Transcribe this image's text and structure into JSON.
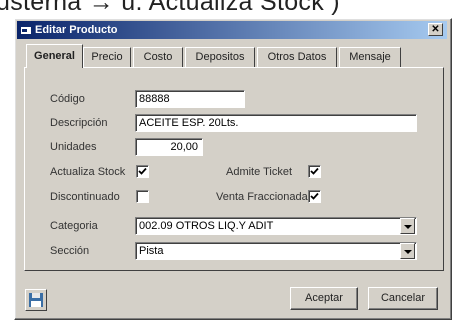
{
  "background_caption": "usterna → u.   Actualiza Stock )",
  "window": {
    "title": "Editar Producto",
    "close_label": "✕"
  },
  "tabs": [
    {
      "label": "General",
      "active": true
    },
    {
      "label": "Precio",
      "active": false
    },
    {
      "label": "Costo",
      "active": false
    },
    {
      "label": "Depositos",
      "active": false
    },
    {
      "label": "Otros Datos",
      "active": false
    },
    {
      "label": "Mensaje",
      "active": false
    }
  ],
  "form": {
    "codigo": {
      "label": "Código",
      "value": "88888"
    },
    "descripcion": {
      "label": "Descripción",
      "value": "ACEITE  ESP. 20Lts."
    },
    "unidades": {
      "label": "Unidades",
      "value": "20,00"
    },
    "actualiza_stock": {
      "label": "Actualiza Stock",
      "checked": true
    },
    "admite_ticket": {
      "label": "Admite Ticket",
      "checked": true
    },
    "discontinuado": {
      "label": "Discontinuado",
      "checked": false
    },
    "venta_fraccionada": {
      "label": "Venta Fraccionada",
      "checked": true
    },
    "categoria": {
      "label": "Categoria",
      "value": "002.09 OTROS LIQ.Y ADIT"
    },
    "seccion": {
      "label": "Sección",
      "value": "Pista"
    }
  },
  "buttons": {
    "accept": "Aceptar",
    "cancel": "Cancelar"
  },
  "colors": {
    "title_start": "#0a246a",
    "title_end": "#a6caf0",
    "face": "#d4d0c8"
  }
}
